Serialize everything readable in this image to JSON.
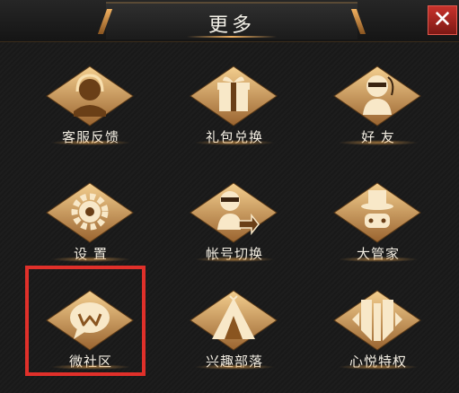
{
  "header": {
    "title": "更多",
    "close_label": "✕"
  },
  "items": [
    {
      "label": "客服反馈",
      "icon": "customer-service-headset-icon"
    },
    {
      "label": "礼包兑换",
      "icon": "gift-box-icon"
    },
    {
      "label": "好 友",
      "icon": "friend-figure-icon"
    },
    {
      "label": "设 置",
      "icon": "gear-icon"
    },
    {
      "label": "帐号切换",
      "icon": "account-switch-icon"
    },
    {
      "label": "大管家",
      "icon": "butler-tophat-icon"
    },
    {
      "label": "微社区",
      "icon": "community-chat-bubble-icon"
    },
    {
      "label": "兴趣部落",
      "icon": "tribe-tent-icon"
    },
    {
      "label": "心悦特权",
      "icon": "privilege-emblem-icon"
    }
  ],
  "colors": {
    "gold": "#d9a15a",
    "gold_dark": "#8a5a28",
    "highlight": "#e0302a"
  }
}
